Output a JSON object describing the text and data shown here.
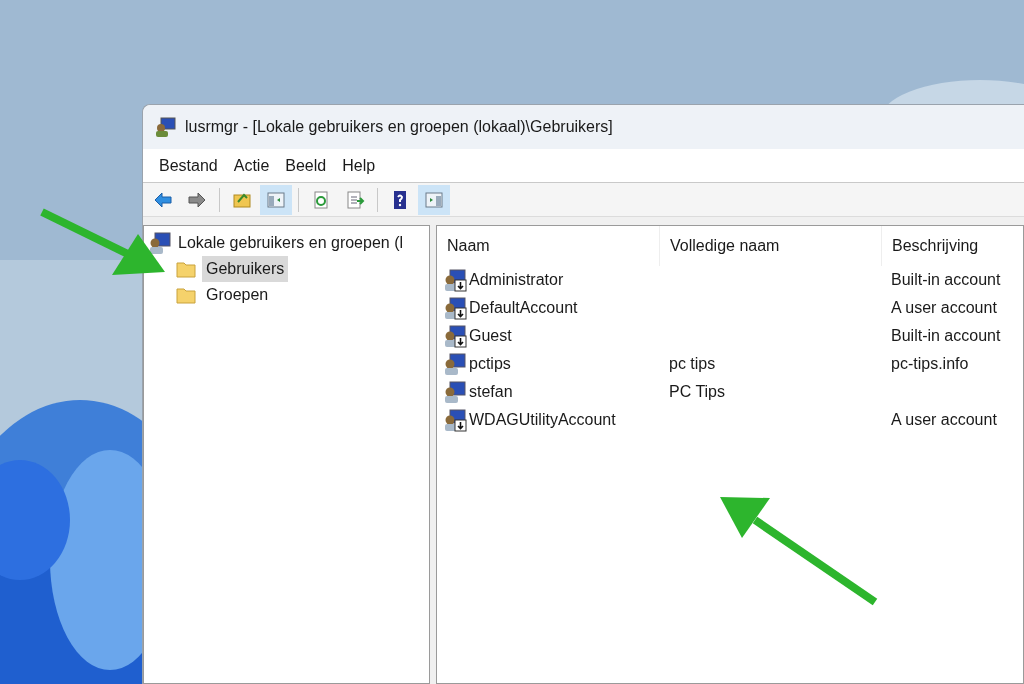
{
  "window": {
    "title": "lusrmgr - [Lokale gebruikers en groepen (lokaal)\\Gebruikers]"
  },
  "menu": [
    "Bestand",
    "Actie",
    "Beeld",
    "Help"
  ],
  "toolbar": [
    {
      "kind": "back",
      "selected": false
    },
    {
      "kind": "forward",
      "selected": false
    },
    {
      "kind": "separator"
    },
    {
      "kind": "up",
      "selected": false
    },
    {
      "kind": "tree",
      "selected": true
    },
    {
      "kind": "separator"
    },
    {
      "kind": "refresh",
      "selected": false
    },
    {
      "kind": "export",
      "selected": false
    },
    {
      "kind": "separator"
    },
    {
      "kind": "help",
      "selected": false
    },
    {
      "kind": "actionpane",
      "selected": true
    }
  ],
  "tree": {
    "label": "Lokale gebruikers en groepen (l",
    "children": [
      {
        "label": "Gebruikers",
        "selected": true
      },
      {
        "label": "Groepen",
        "selected": false
      }
    ]
  },
  "table": {
    "columns": [
      "Naam",
      "Volledige naam",
      "Beschrijving"
    ],
    "rows": [
      {
        "name": "Administrator",
        "full_name": "",
        "description": "Built-in account",
        "disabled": true
      },
      {
        "name": "DefaultAccount",
        "full_name": "",
        "description": "A user account",
        "disabled": true
      },
      {
        "name": "Guest",
        "full_name": "",
        "description": "Built-in account",
        "disabled": true
      },
      {
        "name": "pctips",
        "full_name": "pc tips",
        "description": "pc-tips.info",
        "disabled": false
      },
      {
        "name": "stefan",
        "full_name": "PC Tips",
        "description": "",
        "disabled": false
      },
      {
        "name": "WDAGUtilityAccount",
        "full_name": "",
        "description": "A user account",
        "disabled": true
      }
    ]
  }
}
